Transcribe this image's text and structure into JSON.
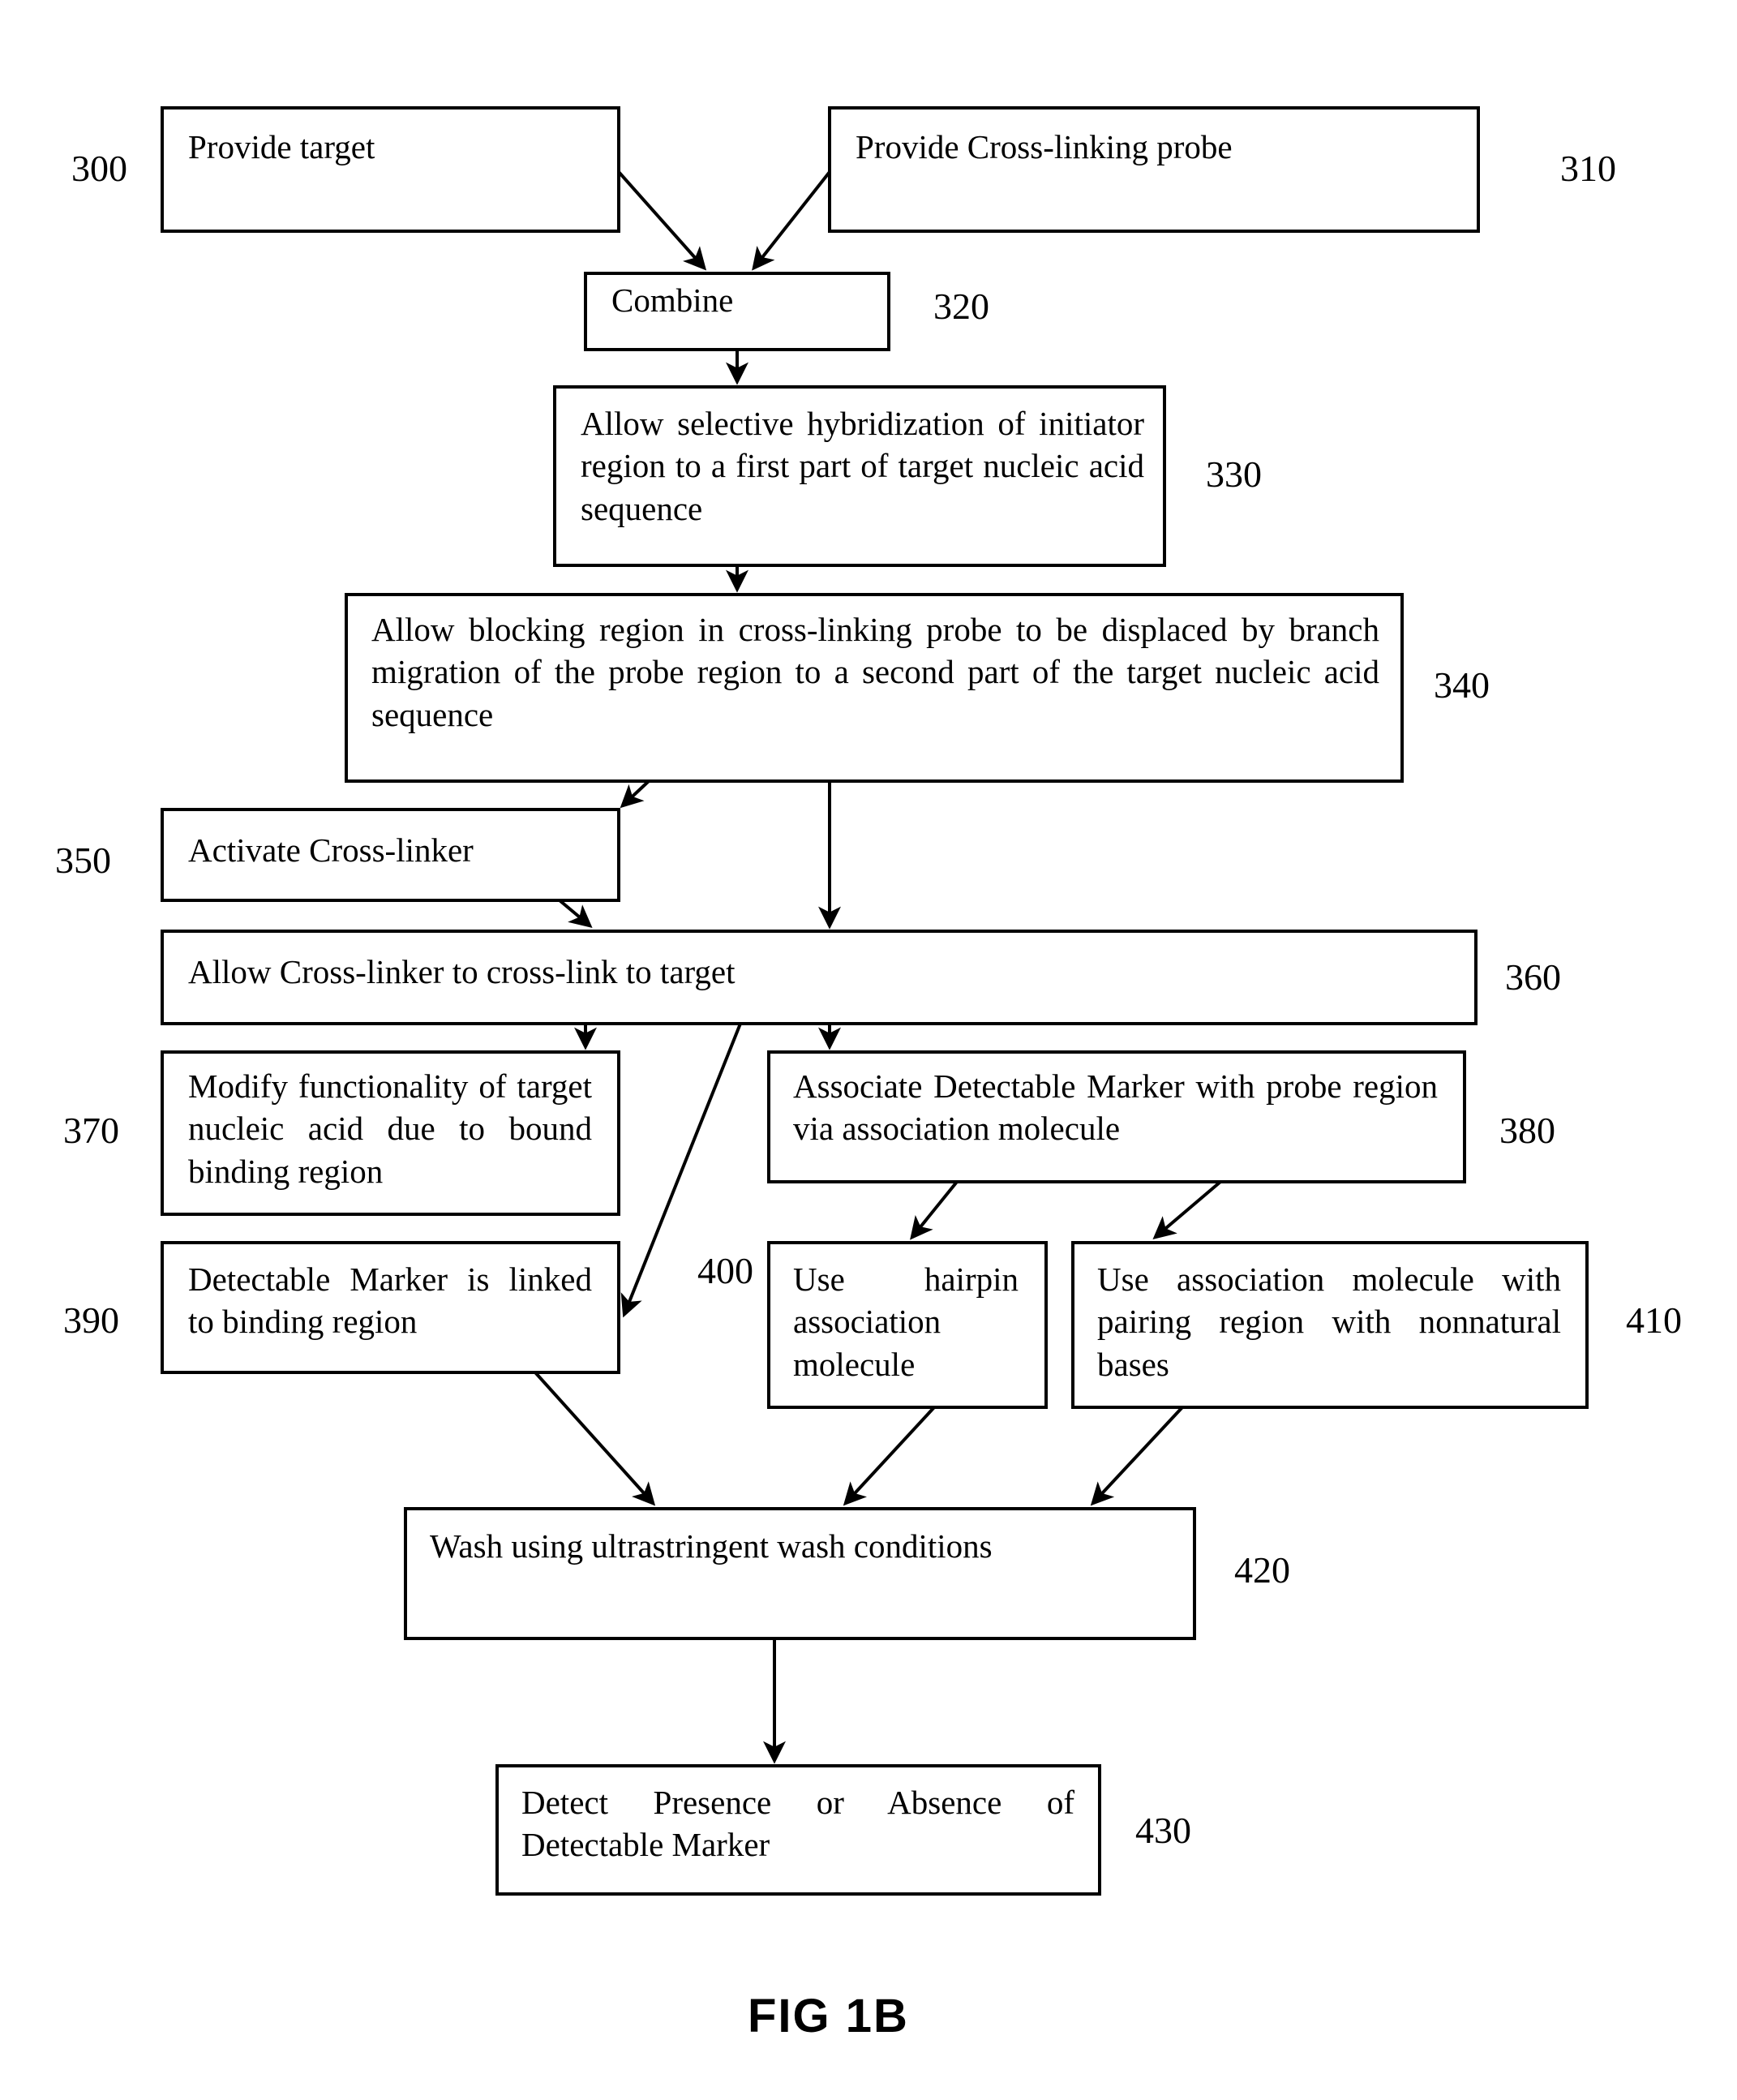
{
  "figure": {
    "label": "FIG 1B",
    "caption_label": "FIG 1B"
  },
  "nodes": [
    {
      "id": "300",
      "ref": "300",
      "text": "Provide target",
      "ref_side": "left"
    },
    {
      "id": "310",
      "ref": "310",
      "text": "Provide Cross-linking probe",
      "ref_side": "right"
    },
    {
      "id": "320",
      "ref": "320",
      "text": "Combine",
      "ref_side": "right"
    },
    {
      "id": "330",
      "ref": "330",
      "text": "Allow selective hybridization of initiator region to a first part of target nucleic acid sequence",
      "ref_side": "right"
    },
    {
      "id": "340",
      "ref": "340",
      "text": "Allow blocking region in cross-linking probe to be displaced by branch migration of the probe region to a second part of the target nucleic acid sequence",
      "ref_side": "right"
    },
    {
      "id": "350",
      "ref": "350",
      "text": "Activate Cross-linker",
      "ref_side": "left"
    },
    {
      "id": "360",
      "ref": "360",
      "text": "Allow Cross-linker to cross-link to target",
      "ref_side": "right"
    },
    {
      "id": "370",
      "ref": "370",
      "text": "Modify functionality of target nucleic acid due to bound binding region",
      "ref_side": "left"
    },
    {
      "id": "380",
      "ref": "380",
      "text": "Associate Detectable Marker with probe region via association molecule",
      "ref_side": "right"
    },
    {
      "id": "390",
      "ref": "390",
      "text": "Detectable Marker is linked to binding region",
      "ref_side": "left"
    },
    {
      "id": "400",
      "ref": "400",
      "text": "Use hairpin association molecule",
      "ref_side": "left"
    },
    {
      "id": "410",
      "ref": "410",
      "text": "Use association molecule with pairing region with nonnatural bases",
      "ref_side": "right"
    },
    {
      "id": "420",
      "ref": "420",
      "text": "Wash using ultrastringent wash conditions",
      "ref_side": "right"
    },
    {
      "id": "430",
      "ref": "430",
      "text": "Detect Presence or Absence of Detectable Marker",
      "ref_side": "right"
    }
  ],
  "colors": {
    "stroke": "#000000",
    "fill": "#ffffff",
    "text": "#000000"
  }
}
